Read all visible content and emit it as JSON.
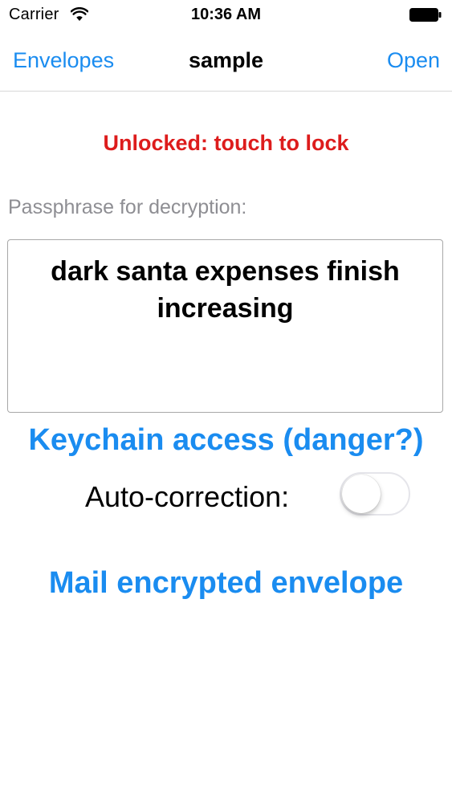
{
  "status_bar": {
    "carrier": "Carrier",
    "time": "10:36 AM",
    "wifi_icon": "wifi-icon",
    "battery_icon": "battery-icon"
  },
  "nav": {
    "back_label": "Envelopes",
    "title": "sample",
    "action_label": "Open"
  },
  "lock_status": {
    "text": "Unlocked: touch to lock",
    "color": "#dd1c1c"
  },
  "passphrase": {
    "label": "Passphrase for decryption:",
    "value": "dark santa expenses finish increasing"
  },
  "keychain_button": {
    "label": "Keychain access (danger?)"
  },
  "autocorrection": {
    "label": "Auto-correction:",
    "enabled": false
  },
  "mail_button": {
    "label": "Mail encrypted envelope"
  },
  "colors": {
    "accent": "#1a8cf0",
    "warning": "#dd1c1c",
    "placeholder_gray": "#8e8e93"
  }
}
